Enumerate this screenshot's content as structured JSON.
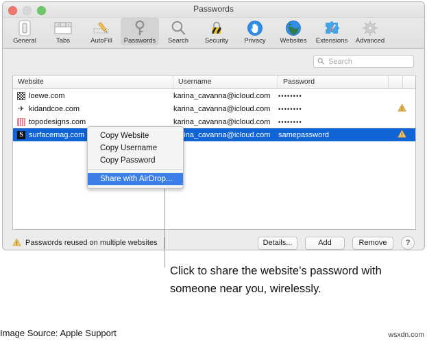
{
  "window": {
    "title": "Passwords",
    "traffic_lights": [
      "close",
      "minimize",
      "zoom"
    ]
  },
  "toolbar": {
    "items": [
      {
        "label": "General",
        "icon": "switch-icon",
        "selected": false
      },
      {
        "label": "Tabs",
        "icon": "tabs-icon",
        "selected": false
      },
      {
        "label": "AutoFill",
        "icon": "pencil-icon",
        "selected": false
      },
      {
        "label": "Passwords",
        "icon": "key-icon",
        "selected": true
      },
      {
        "label": "Search",
        "icon": "magnifier-icon",
        "selected": false
      },
      {
        "label": "Security",
        "icon": "padlock-icon",
        "selected": false
      },
      {
        "label": "Privacy",
        "icon": "hand-icon",
        "selected": false
      },
      {
        "label": "Websites",
        "icon": "globe-icon",
        "selected": false
      },
      {
        "label": "Extensions",
        "icon": "puzzle-icon",
        "selected": false
      },
      {
        "label": "Advanced",
        "icon": "gear-icon",
        "selected": false
      }
    ]
  },
  "search": {
    "placeholder": "Search",
    "value": "",
    "icon": "search-icon"
  },
  "table": {
    "columns": [
      "Website",
      "Username",
      "Password"
    ],
    "rows": [
      {
        "website": "loewe.com",
        "username": "karina_cavanna@icloud.com",
        "password": "••••••••",
        "favicon": "checkered-grid-icon",
        "warning": false,
        "selected": false
      },
      {
        "website": "kidandcoe.com",
        "username": "karina_cavanna@icloud.com",
        "password": "••••••••",
        "favicon": "airplane-icon",
        "warning": true,
        "selected": false
      },
      {
        "website": "topodesigns.com",
        "username": "karina_cavanna@icloud.com",
        "password": "••••••••",
        "favicon": "pink-stripes-icon",
        "warning": false,
        "selected": false
      },
      {
        "website": "surfacemag.com",
        "username": "karina_cavanna@icloud.com",
        "password": "samepassword",
        "favicon": "letter-s-icon",
        "warning": true,
        "selected": true
      }
    ]
  },
  "footer_bar": {
    "warning_icon": "warning-triangle-icon",
    "reuse_note": "Passwords reused on multiple websites",
    "buttons": {
      "details": "Details...",
      "add": "Add",
      "remove": "Remove",
      "help": "?"
    }
  },
  "context_menu": {
    "items": [
      {
        "label": "Copy Website",
        "highlighted": false,
        "separator_after": false
      },
      {
        "label": "Copy Username",
        "highlighted": false,
        "separator_after": false
      },
      {
        "label": "Copy Password",
        "highlighted": false,
        "separator_after": true
      },
      {
        "label": "Share with AirDrop...",
        "highlighted": true,
        "separator_after": false
      }
    ]
  },
  "annotation": {
    "caption": "Click to share the website’s password with someone near you, wirelessly."
  },
  "page_footer": {
    "source": "Image Source: Apple Support",
    "watermark": "wsxdn.com"
  },
  "colors": {
    "selection_blue": "#1064d6",
    "menu_highlight_blue": "#3c7fe8",
    "warning_gold": "#e0a83a",
    "window_chrome": "#ececec"
  }
}
